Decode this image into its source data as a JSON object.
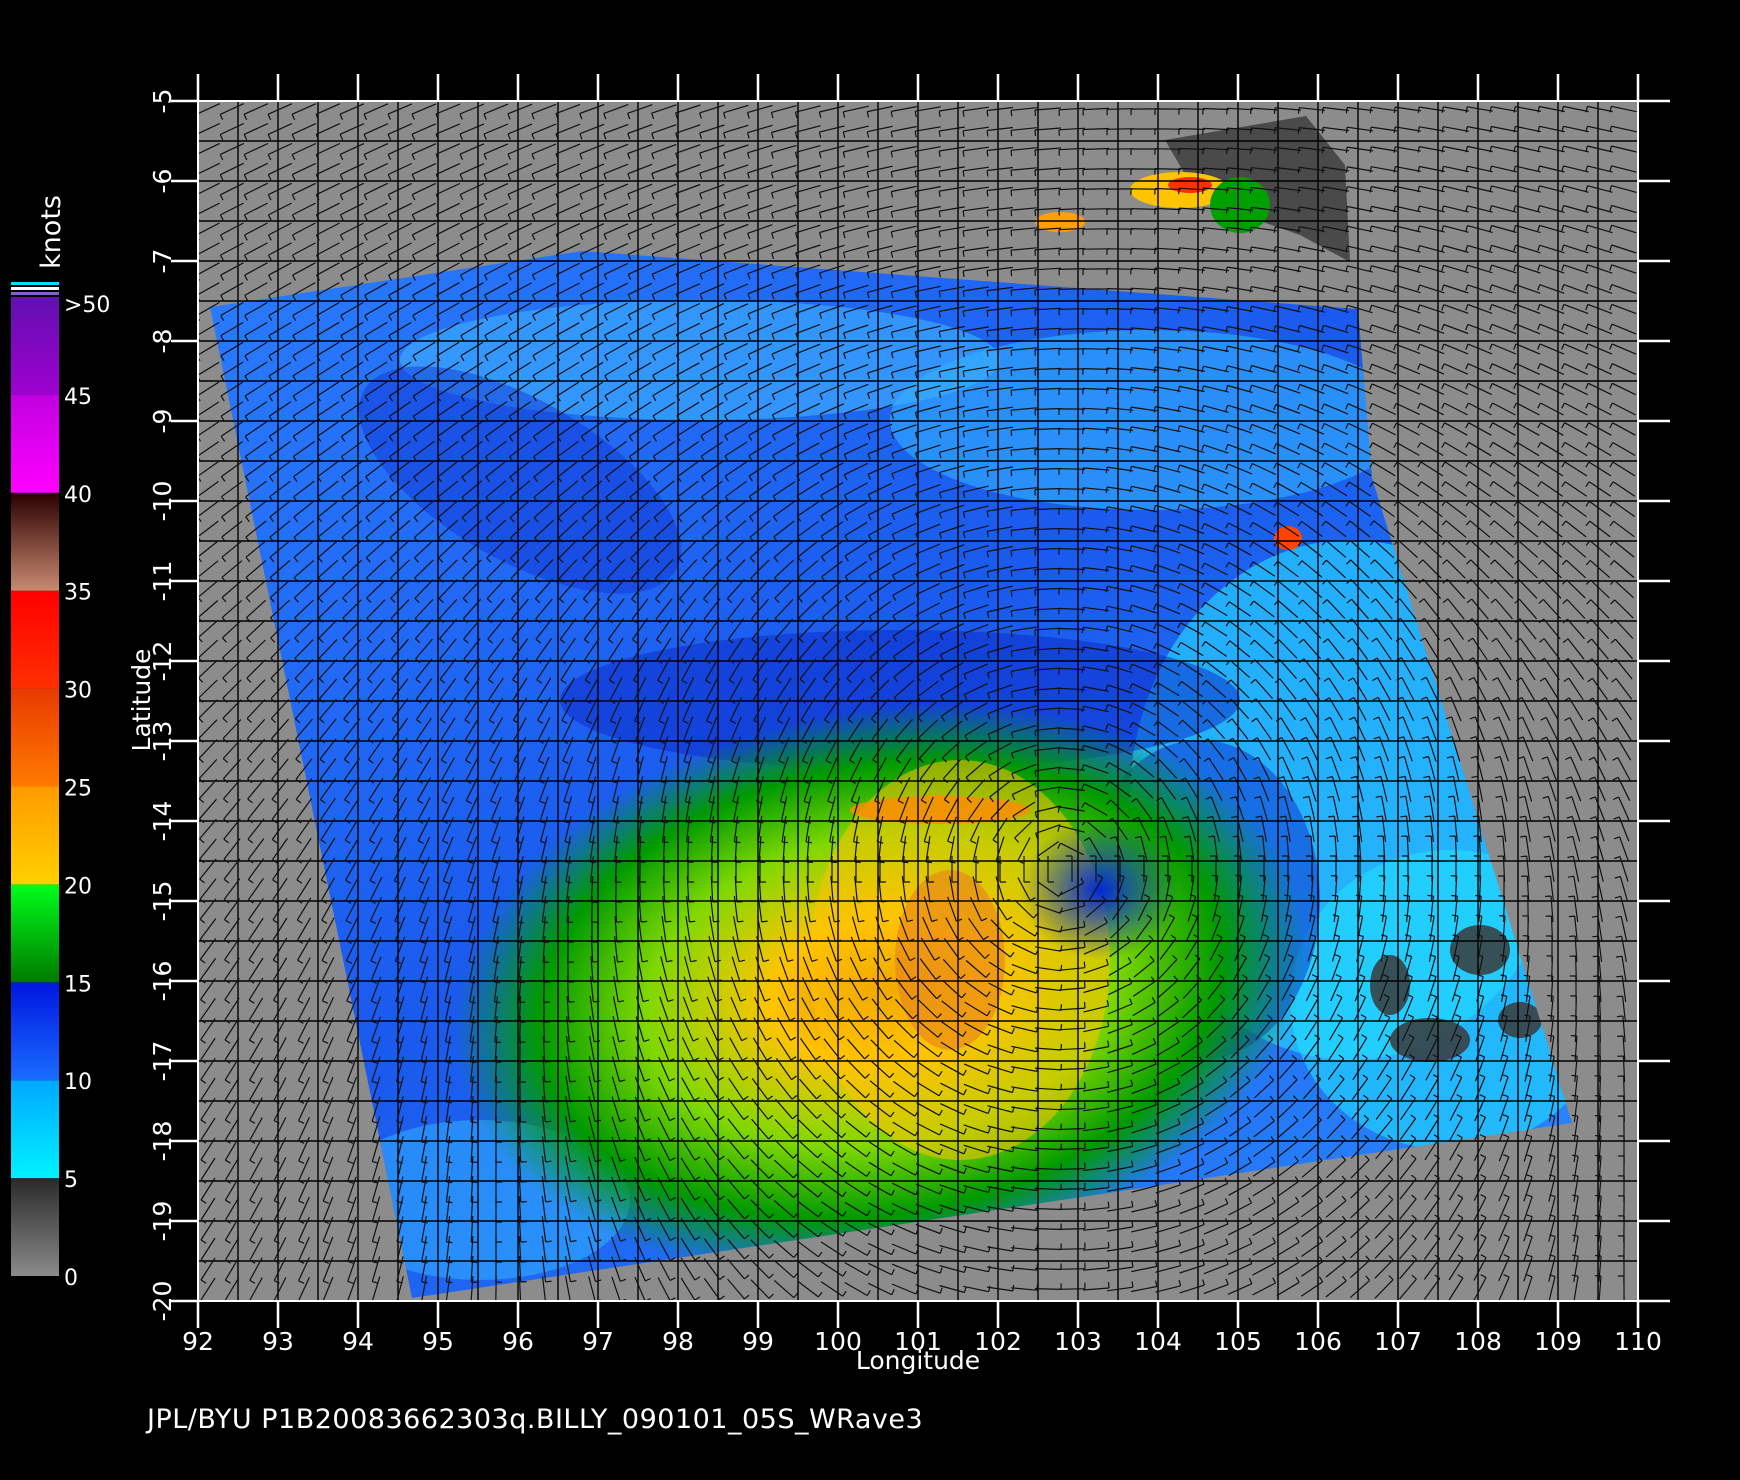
{
  "colorbar": {
    "unit": "knots",
    "labels": [
      "0",
      "5",
      "10",
      "15",
      "20",
      "25",
      "30",
      "35",
      "40",
      "45",
      ">50"
    ],
    "stops": [
      {
        "from": 0,
        "to": 5,
        "colors": [
          "#8a8a8a",
          "#2a2a2a"
        ]
      },
      {
        "from": 5,
        "to": 10,
        "colors": [
          "#00f2ff",
          "#00a8ff"
        ]
      },
      {
        "from": 10,
        "to": 15,
        "colors": [
          "#1a6cff",
          "#0016e0"
        ]
      },
      {
        "from": 15,
        "to": 20,
        "colors": [
          "#007a00",
          "#00ff1a"
        ]
      },
      {
        "from": 20,
        "to": 25,
        "colors": [
          "#ffd000",
          "#ff9a00"
        ]
      },
      {
        "from": 25,
        "to": 30,
        "colors": [
          "#ff7a00",
          "#e83a00"
        ]
      },
      {
        "from": 30,
        "to": 35,
        "colors": [
          "#ff3000",
          "#ff0000"
        ]
      },
      {
        "from": 35,
        "to": 40,
        "colors": [
          "#c88a70",
          "#2a0000"
        ]
      },
      {
        "from": 40,
        "to": 45,
        "colors": [
          "#ff00ff",
          "#c000e0"
        ]
      },
      {
        "from": 45,
        "to": 50,
        "colors": [
          "#a000d0",
          "#6010b0"
        ]
      }
    ]
  },
  "map": {
    "x_axis_title": "Longitude",
    "y_axis_title": "Latitude",
    "lon_ticks": [
      "92",
      "93",
      "94",
      "95",
      "96",
      "97",
      "98",
      "99",
      "100",
      "101",
      "102",
      "103",
      "104",
      "105",
      "106",
      "107",
      "108",
      "109",
      "110"
    ],
    "lat_ticks": [
      "-5",
      "-6",
      "-7",
      "-8",
      "-9",
      "-10",
      "-11",
      "-12",
      "-13",
      "-14",
      "-15",
      "-16",
      "-17",
      "-18",
      "-19",
      "-20"
    ],
    "lon_range": [
      92,
      110
    ],
    "lat_range": [
      -20,
      -5
    ],
    "background_color": "#8c8c8c",
    "storm_center_lon": 102.8,
    "storm_center_lat": -14.6
  },
  "footer": {
    "text": "JPL/BYU  P1B20083662303q.BILLY_090101_05S_WRave3"
  }
}
